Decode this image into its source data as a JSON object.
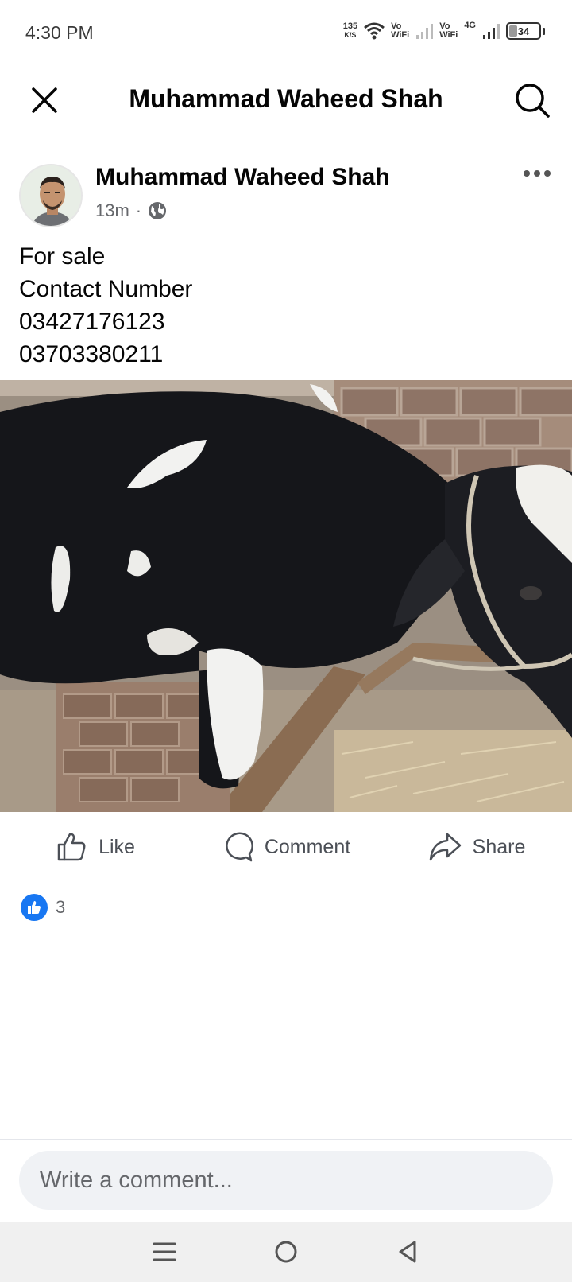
{
  "status_bar": {
    "time": "4:30 PM",
    "net_speed_value": "135",
    "net_speed_unit": "K/S",
    "vowifi_1": "Vo",
    "vowifi_1b": "WiFi",
    "vowifi_2": "Vo",
    "vowifi_2b": "WiFi",
    "network_type": "4G",
    "battery_level": "34",
    "battery_fraction": 0.34
  },
  "header": {
    "title": "Muhammad Waheed Shah",
    "close_icon": "close-icon",
    "search_icon": "search-icon"
  },
  "post": {
    "author": "Muhammad Waheed Shah",
    "time_ago": "13m",
    "separator": "·",
    "privacy_icon": "globe-icon",
    "text_lines": [
      "For sale",
      "Contact Number",
      "03427176123",
      "03703380211"
    ]
  },
  "actions": {
    "like": "Like",
    "comment": "Comment",
    "share": "Share"
  },
  "reactions": {
    "count": "3"
  },
  "comment_box": {
    "placeholder": "Write a comment..."
  },
  "colors": {
    "accent": "#1877f2",
    "text_primary": "#050505",
    "text_secondary": "#65676b"
  }
}
